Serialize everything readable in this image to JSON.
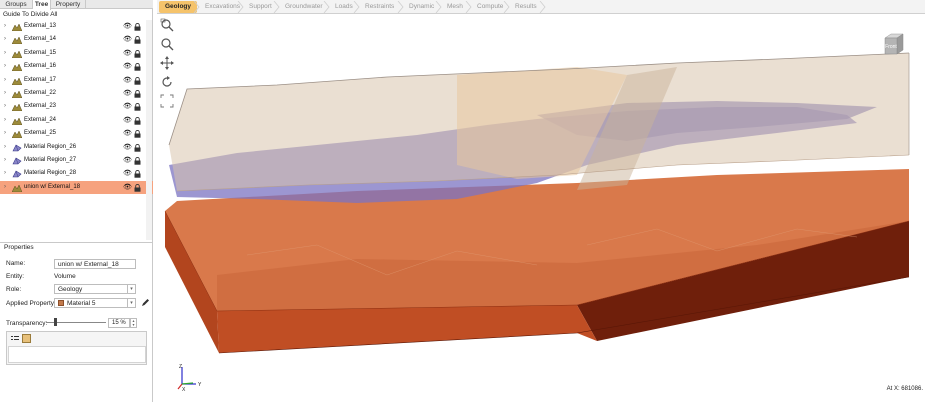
{
  "left_tabs": [
    "Groups",
    "Tree",
    "Property"
  ],
  "active_left_tab": "Tree",
  "guide_text": "Guide To Divide All",
  "tree": [
    {
      "label": "External_13",
      "type": "external"
    },
    {
      "label": "External_14",
      "type": "external"
    },
    {
      "label": "External_15",
      "type": "external"
    },
    {
      "label": "External_16",
      "type": "external"
    },
    {
      "label": "External_17",
      "type": "external"
    },
    {
      "label": "External_22",
      "type": "external"
    },
    {
      "label": "External_23",
      "type": "external"
    },
    {
      "label": "External_24",
      "type": "external"
    },
    {
      "label": "External_25",
      "type": "external"
    },
    {
      "label": "Material Region_26",
      "type": "region"
    },
    {
      "label": "Material Region_27",
      "type": "region"
    },
    {
      "label": "Material Region_28",
      "type": "region"
    },
    {
      "label": "union w/ External_18",
      "type": "external",
      "selected": true
    }
  ],
  "properties": {
    "header": "Properties",
    "name_label": "Name:",
    "name_value": "union w/ External_18",
    "entity_label": "Entity:",
    "entity_value": "Volume",
    "role_label": "Role:",
    "role_value": "Geology",
    "applied_label": "Applied Property:",
    "applied_value": "Material 5",
    "transparency_label": "Transparency:",
    "transparency_value": "15 %",
    "transparency_level": 0.15
  },
  "workflow_tabs": [
    "Geology",
    "Excavations",
    "Support",
    "Groundwater",
    "Loads",
    "Restraints",
    "Dynamic",
    "Mesh",
    "Compute",
    "Results"
  ],
  "active_workflow_tab": "Geology",
  "view_cube_label": "Front",
  "coordinate_readout": "At X: 681086.",
  "axes": {
    "z": "Z",
    "x": "X",
    "y": "Y"
  },
  "icons": [
    "zoom-window-icon",
    "zoom-icon",
    "pan-icon",
    "rotate-icon",
    "fit-icon",
    "eye-icon",
    "lock-icon"
  ],
  "colors": {
    "accent": "#f5c36b",
    "selection": "#f6a27e",
    "base_layer": "#c8552a",
    "clay_layer": "#8f87c9"
  }
}
